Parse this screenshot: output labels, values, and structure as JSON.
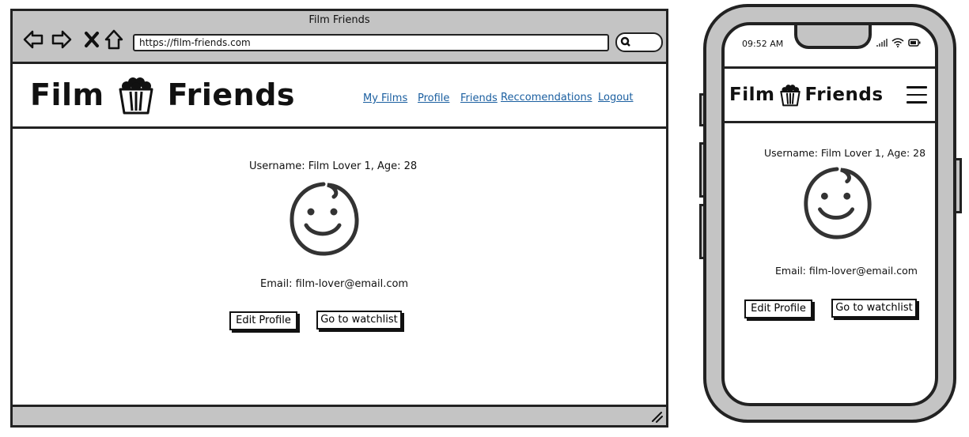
{
  "browser": {
    "window_title": "Film Friends",
    "url": "https://film-friends.com"
  },
  "site": {
    "logo_left": "Film",
    "logo_right": "Friends",
    "nav": [
      {
        "label": "My Films"
      },
      {
        "label": "Profile"
      },
      {
        "label": "Friends"
      },
      {
        "label": "Reccomendations"
      },
      {
        "label": "Logout"
      }
    ]
  },
  "profile": {
    "username_line": "Username: Film Lover 1, Age: 28",
    "email_line": "Email: film-lover@email.com",
    "edit_button": "Edit Profile",
    "watchlist_button": "Go to watchlist"
  },
  "phone": {
    "time": "09:52 AM",
    "logo_left": "Film",
    "logo_right": "Friends",
    "username_line": "Username: Film Lover 1, Age: 28",
    "email_line": "Email: film-lover@email.com",
    "edit_button": "Edit Profile",
    "watchlist_button": "Go to watchlist"
  },
  "icons": {
    "back": "back-arrow-icon",
    "forward": "forward-arrow-icon",
    "stop": "close-icon",
    "home": "home-icon",
    "search": "search-icon",
    "logo": "popcorn-icon",
    "avatar": "smiley-face-icon",
    "menu": "hamburger-menu-icon",
    "signal": "signal-icon",
    "wifi": "wifi-icon",
    "battery": "battery-icon",
    "resize": "resize-handle-icon"
  }
}
